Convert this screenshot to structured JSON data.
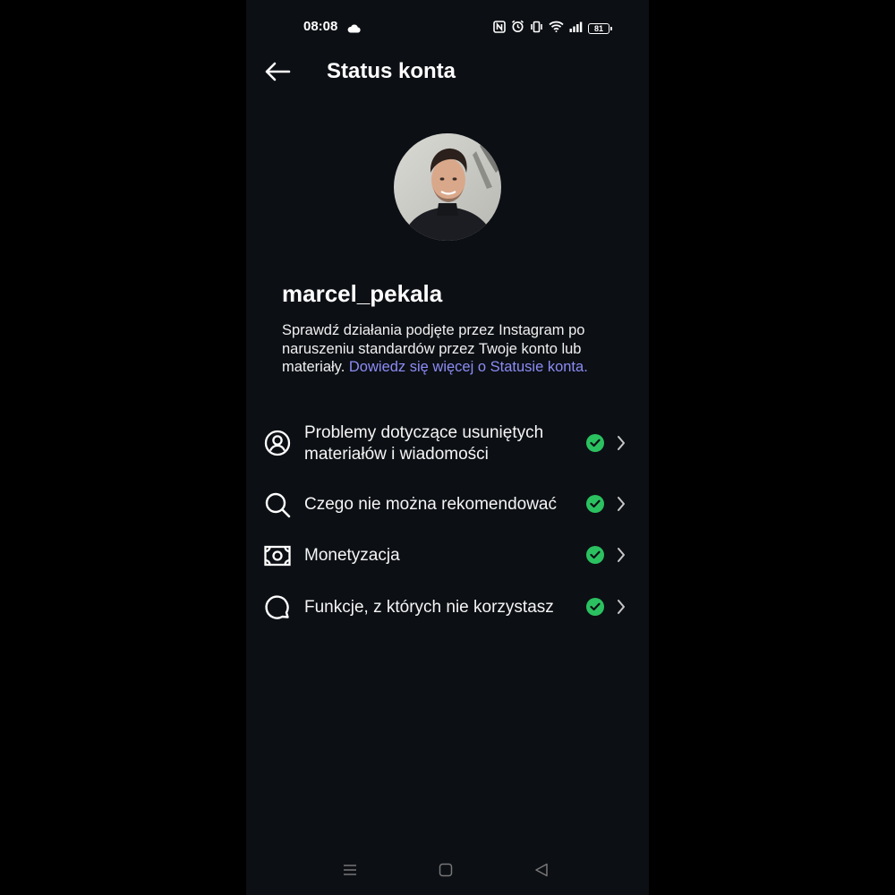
{
  "status_bar": {
    "time": "08:08",
    "battery": "81",
    "icons": [
      "cloud-icon",
      "nfc-icon",
      "alarm-icon",
      "vibrate-icon",
      "wifi-icon",
      "signal-icon",
      "battery-icon"
    ]
  },
  "header": {
    "title": "Status konta",
    "back_icon": "arrow-left-icon"
  },
  "profile": {
    "username": "marcel_pekala",
    "description": "Sprawdź działania podjęte przez Instagram po naruszeniu standardów przez Twoje konto lub materiały.",
    "learn_more": "Dowiedz się więcej o Statusie konta."
  },
  "items": [
    {
      "icon": "user-circle-icon",
      "label": "Problemy dotyczące usuniętych materiałów i wiadomości",
      "status": "ok"
    },
    {
      "icon": "search-icon",
      "label": "Czego nie można rekomendować",
      "status": "ok"
    },
    {
      "icon": "money-icon",
      "label": "Monetyzacja",
      "status": "ok"
    },
    {
      "icon": "chat-bubble-icon",
      "label": "Funkcje, z których nie korzystasz",
      "status": "ok"
    }
  ],
  "nav_bar": [
    "menu-icon",
    "home-square-icon",
    "back-triangle-icon"
  ],
  "colors": {
    "background": "#0c0f14",
    "link": "#8c8cf5",
    "check": "#2bc160"
  }
}
